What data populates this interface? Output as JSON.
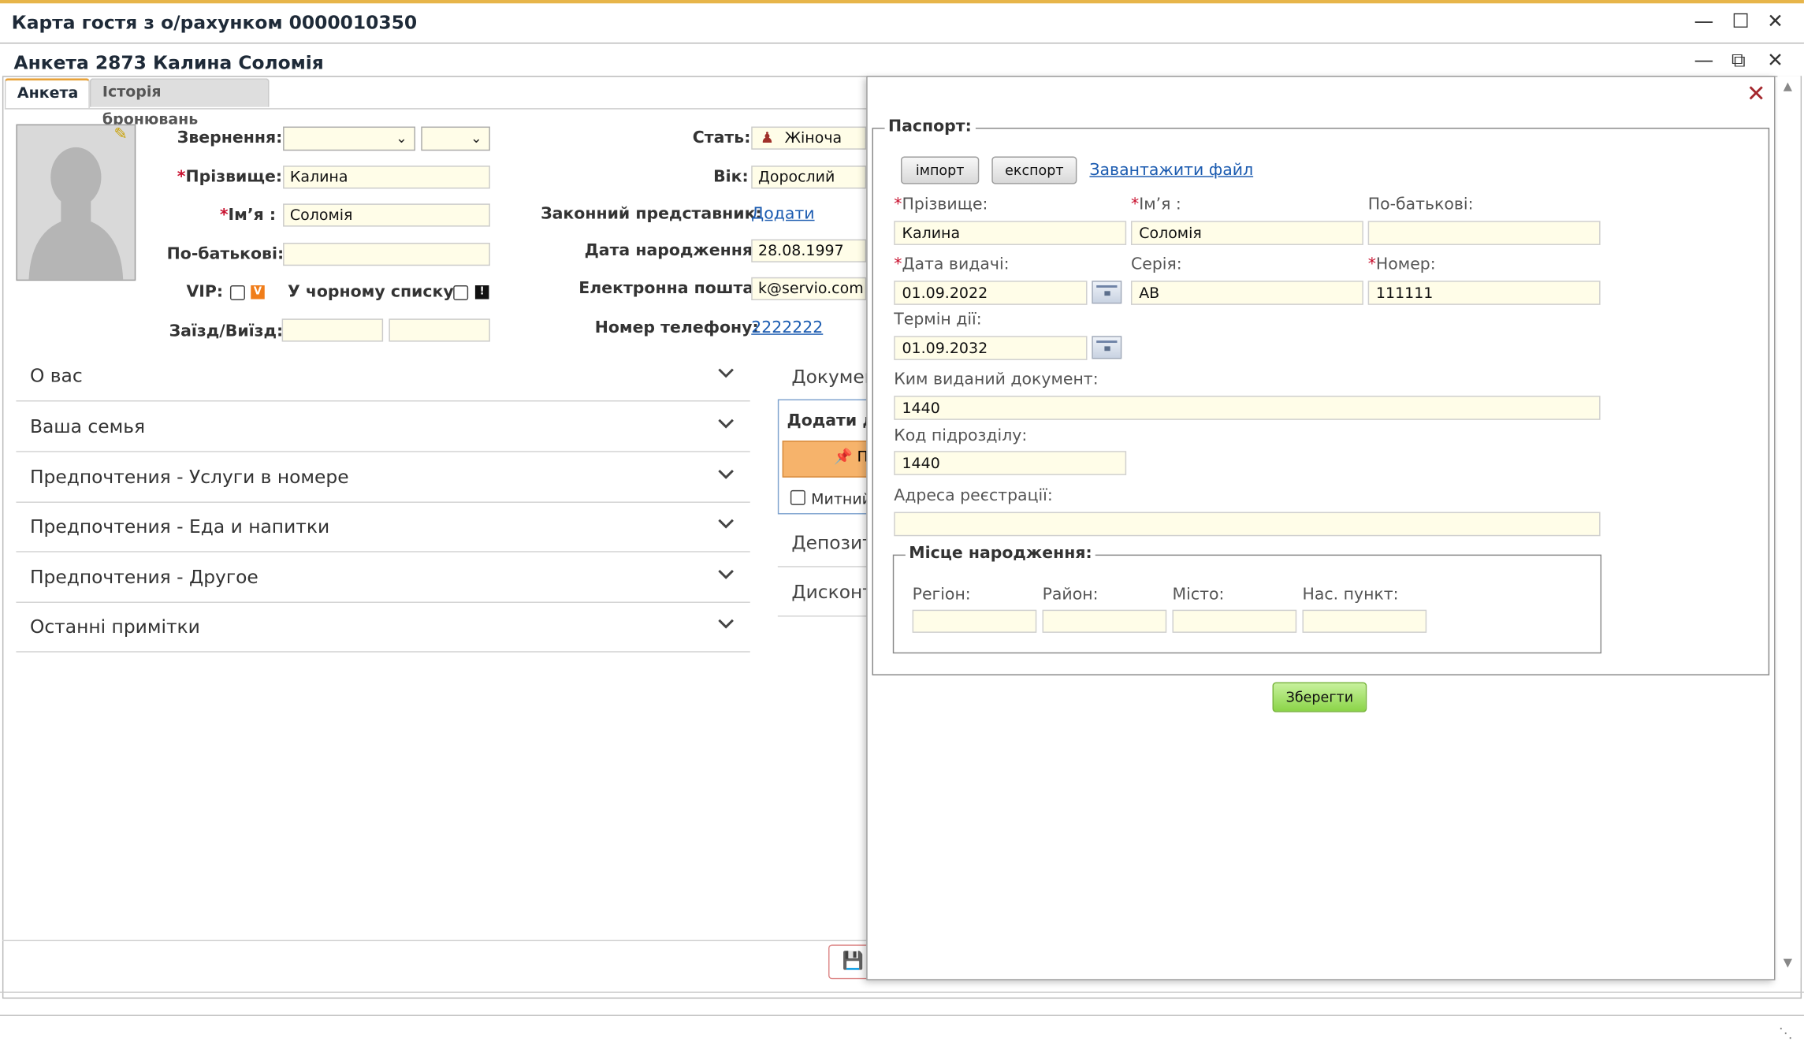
{
  "window": {
    "title": "Карта гостя з о/рахунком 0000010350",
    "inner_title": "Анкета 2873 Калина Соломія"
  },
  "tabs": [
    {
      "label": "Анкета",
      "active": true
    },
    {
      "label": "Історія бронювань",
      "active": false
    }
  ],
  "form": {
    "address_label": "Звернення:",
    "surname_label": "Прізвище:",
    "surname": "Калина",
    "name_label": "Ім’я :",
    "name": "Соломія",
    "patronymic_label": "По-батькові:",
    "patronymic": "",
    "vip_label": "VIP:",
    "blacklist_label": "У чорному списку:",
    "checkin_label": "Заїзд/Виїзд:",
    "gender_label": "Стать:",
    "gender": "Жіноча",
    "age_label": "Вік:",
    "age": "Дорослий",
    "legal_rep_label": "Законний представник:",
    "legal_rep_link": "Додати",
    "birthdate_label": "Дата народження:",
    "birthdate": "28.08.1997",
    "email_label": "Електронна пошта:",
    "email": "k@servio.com",
    "phone_label": "Номер телефону:",
    "phone": "2222222"
  },
  "accordion": [
    "О вас",
    "Ваша семья",
    "Предпочтения - Услуги в номере",
    "Предпочтения - Еда и напитки",
    "Предпочтения - Другое",
    "Останні примітки"
  ],
  "right_column": {
    "documents": "Докумен",
    "add_doc": "Додати д",
    "orange_btn": "П",
    "customs_label": "Митний",
    "deposit": "Депозит",
    "discount": "Дисконт"
  },
  "dialog": {
    "fieldset_title": "Паспорт:",
    "import_btn": "імпорт",
    "export_btn": "експорт",
    "upload_link": "Завантажити файл",
    "surname_label": "Прізвище:",
    "surname": "Калина",
    "name_label": "Ім’я :",
    "name": "Соломія",
    "patronymic_label": "По-батькові:",
    "patronymic": "",
    "issue_date_label": "Дата видачі:",
    "issue_date": "01.09.2022",
    "series_label": "Серія:",
    "series": "АВ",
    "number_label": "Номер:",
    "number": "111111",
    "valid_label": "Термін дії:",
    "valid_date": "01.09.2032",
    "issued_by_label": "Ким виданий документ:",
    "issued_by": "1440",
    "unit_code_label": "Код підрозділу:",
    "unit_code": "1440",
    "reg_address_label": "Адреса реєстрації:",
    "reg_address": "",
    "birthplace_title": "Місце народження:",
    "region_label": "Регіон:",
    "district_label": "Район:",
    "city_label": "Місто:",
    "settlement_label": "Нас. пункт:",
    "save_btn": "Зберегти"
  },
  "colors": {
    "accent_tab": "#e7a23b",
    "field_bg": "#fffde8",
    "required": "#c8102e",
    "link": "#1b5bb0",
    "save_green": "#8bd448"
  }
}
